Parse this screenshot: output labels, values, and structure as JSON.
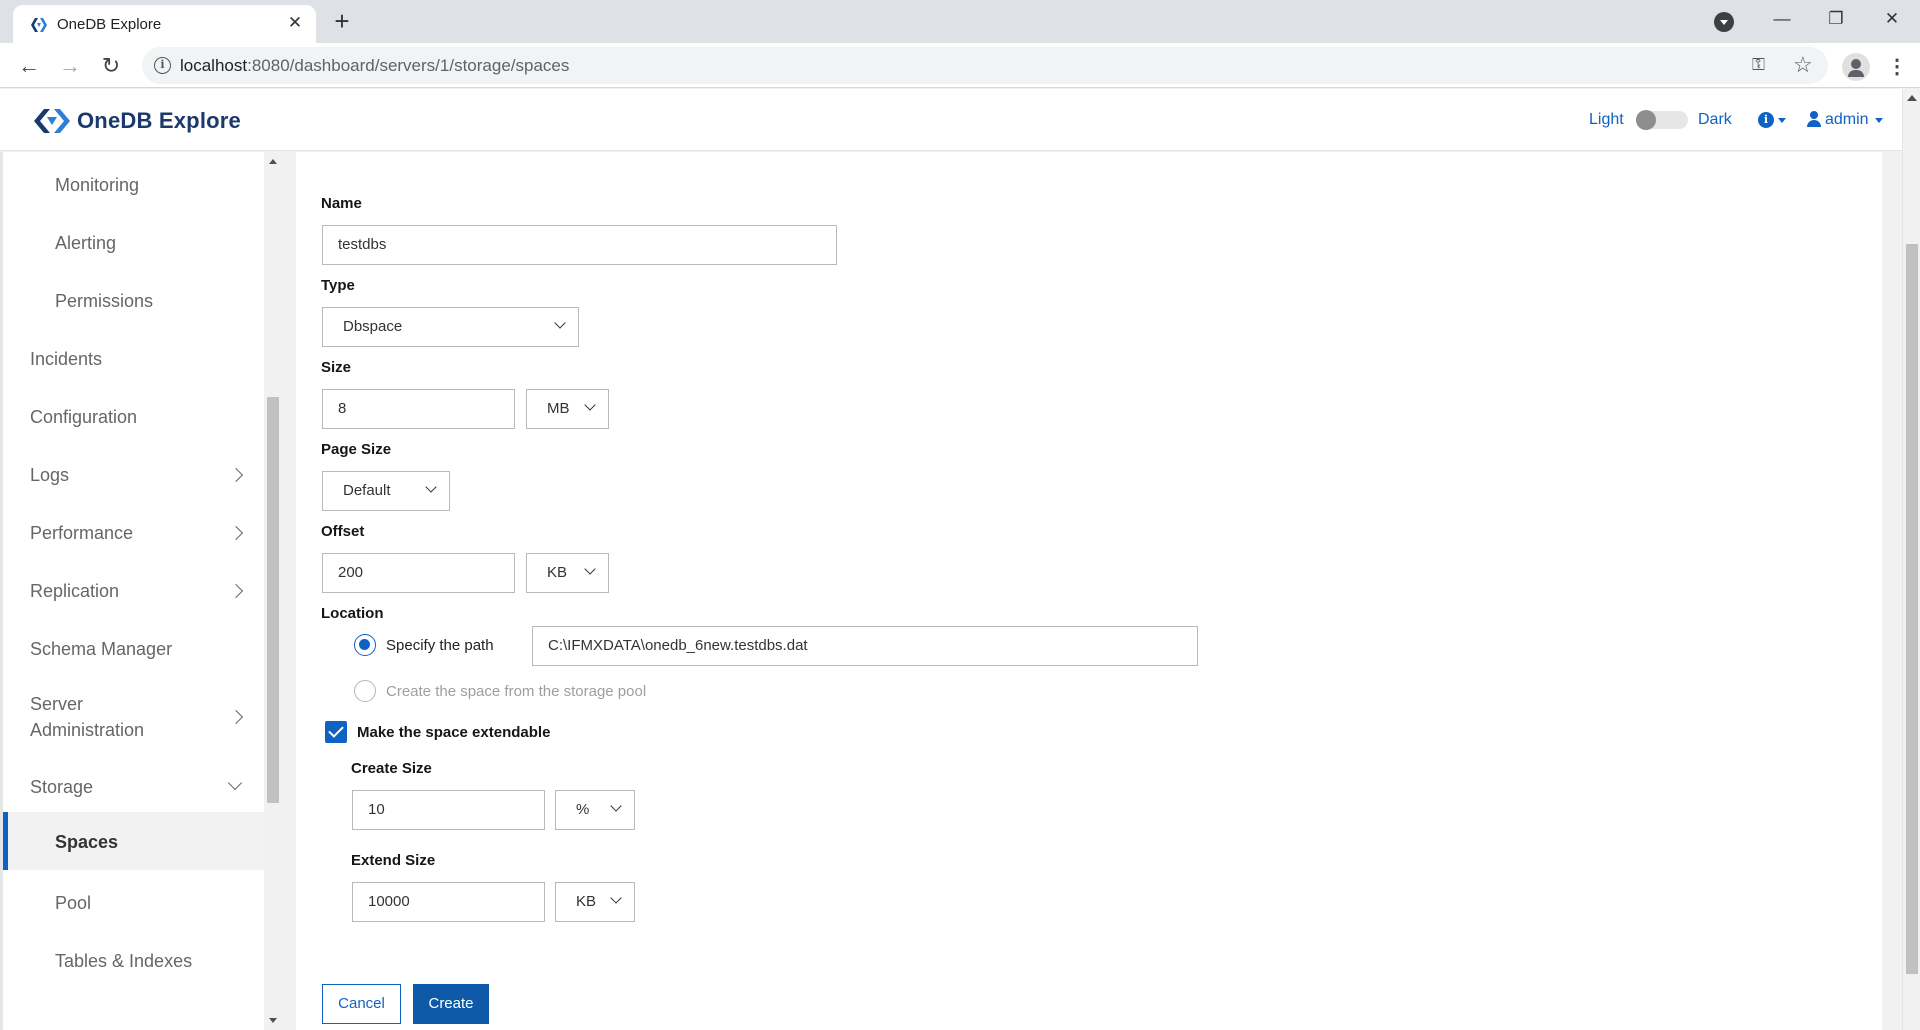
{
  "browser": {
    "tab_title": "OneDB Explore",
    "tab_close": "✕",
    "new_tab": "+",
    "url_host": "localhost",
    "url_path": ":8080/dashboard/servers/1/storage/spaces",
    "minimize": "—",
    "restore": "❐",
    "close": "✕",
    "back": "←",
    "forward": "→",
    "reload": "↻",
    "key_icon": "⚿",
    "star_icon": "☆",
    "menu": "⋮"
  },
  "app": {
    "brand": "OneDB Explore",
    "theme_light": "Light",
    "theme_dark": "Dark",
    "user": "admin",
    "help_glyph": "i"
  },
  "sidebar": {
    "items": [
      {
        "label": "Monitoring"
      },
      {
        "label": "Alerting"
      },
      {
        "label": "Permissions"
      },
      {
        "label": "Incidents"
      },
      {
        "label": "Configuration"
      },
      {
        "label": "Logs"
      },
      {
        "label": "Performance"
      },
      {
        "label": "Replication"
      },
      {
        "label": "Schema Manager"
      },
      {
        "label": "Server"
      },
      {
        "label": "Administration"
      },
      {
        "label": "Storage"
      },
      {
        "label": "Spaces"
      },
      {
        "label": "Pool"
      },
      {
        "label": "Tables & Indexes"
      }
    ]
  },
  "form": {
    "name_label": "Name",
    "name_value": "testdbs",
    "type_label": "Type",
    "type_value": "Dbspace",
    "size_label": "Size",
    "size_value": "8",
    "size_unit": "MB",
    "page_size_label": "Page Size",
    "page_size_value": "Default",
    "offset_label": "Offset",
    "offset_value": "200",
    "offset_unit": "KB",
    "location_label": "Location",
    "radio_path_label": "Specify the path",
    "path_value": "C:\\IFMXDATA\\onedb_6new.testdbs.dat",
    "radio_pool_label": "Create the space from the storage pool",
    "extendable_label": "Make the space extendable",
    "create_size_label": "Create Size",
    "create_size_value": "10",
    "create_size_unit": "%",
    "extend_size_label": "Extend Size",
    "extend_size_value": "10000",
    "extend_size_unit": "KB",
    "cancel_label": "Cancel",
    "create_label": "Create"
  },
  "colors": {
    "accent": "#0f62c4",
    "primary_button": "#0f5aa8",
    "brand_text": "#1a3a6b"
  }
}
